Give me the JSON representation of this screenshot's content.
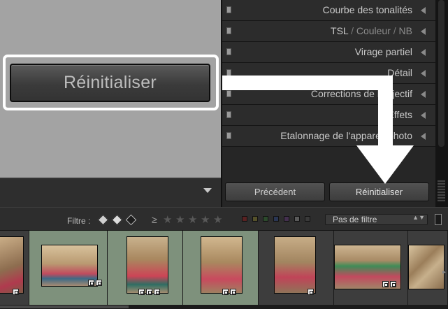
{
  "zoom_callout": {
    "label": "Réinitialiser"
  },
  "panels": [
    {
      "label": "Courbe des tonalités"
    },
    {
      "label": "TSL",
      "parts": [
        "TSL",
        "Couleur",
        "NB"
      ],
      "sep": "/"
    },
    {
      "label": "Virage partiel"
    },
    {
      "label": "Détail"
    },
    {
      "label": "Corrections de l'objectif"
    },
    {
      "label": "Effets"
    },
    {
      "label": "Etalonnage de l'appareil photo"
    }
  ],
  "buttons": {
    "previous": "Précédent",
    "reset": "Réinitialiser"
  },
  "filter": {
    "label": "Filtre :",
    "rating_operator": "≥",
    "star_glyph": "★",
    "dropdown_value": "Pas de filtre",
    "caret": "▲▼"
  },
  "colors": {
    "red": "#b33a3a",
    "yellow": "#b3a23a",
    "green": "#3ea33e",
    "blue": "#3a5fb3",
    "purple": "#8a3ab3",
    "selected_cell": "#7e917c"
  },
  "filmstrip": {
    "arrow": "▸"
  }
}
